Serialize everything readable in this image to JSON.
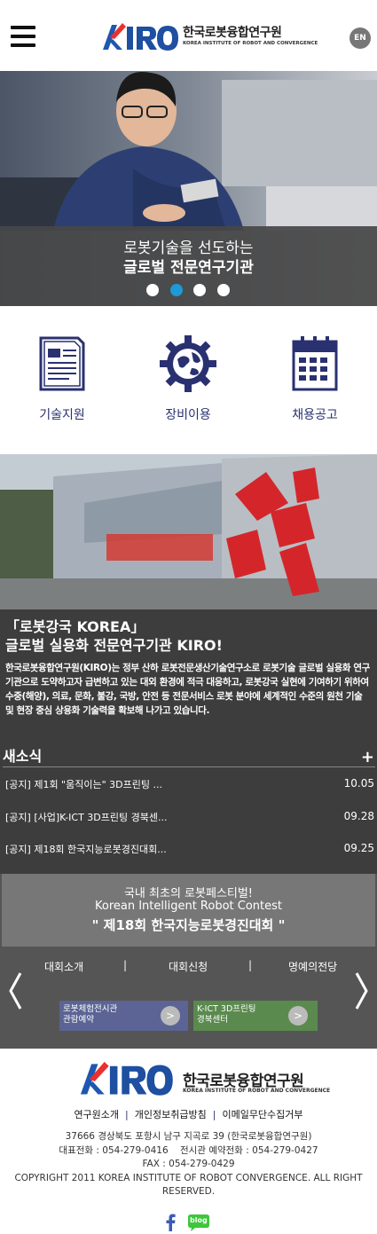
{
  "header": {
    "logo_ko": "한국로봇융합연구원",
    "logo_en": "KOREA INSTITUTE OF ROBOT AND CONVERGENCE",
    "lang": "EN"
  },
  "hero": {
    "line1": "로봇기술을 선도하는",
    "line2": "글로벌 전문연구기관",
    "slides": 4,
    "active_slide": 2
  },
  "quick_menu": [
    {
      "label": "기술지원",
      "icon": "document-icon"
    },
    {
      "label": "장비이용",
      "icon": "gear-globe-icon"
    },
    {
      "label": "채용공고",
      "icon": "calendar-icon"
    }
  ],
  "intro": {
    "title1": "「로봇강국 KOREA」",
    "title2": "글로벌 실용화 전문연구기관 KIRO!",
    "body": "한국로봇융합연구원(KIRO)는 정부 산하 로봇전문생산기술연구소로 로봇기술 글로벌 실용화 연구기관으로 도약하고자 급변하고 있는 대외 환경에 적극 대응하고, 로봇강국 실현에 기여하기 위하여 수중(해양), 의료, 문화, 불강, 국방, 안전 등 전문서비스 로봇 분야에 세계적인 수준의 원천 기술 및 현장 중심 상용화 기술력을 확보해 나가고 있습니다."
  },
  "news": {
    "heading": "새소식",
    "more": "+",
    "items": [
      {
        "title": "[공지] 제1회 \"움직이는\" 3D프린팅 ...",
        "date": "10.05"
      },
      {
        "title": "[공지] [사업]K-ICT 3D프린팅 경북센...",
        "date": "09.28"
      },
      {
        "title": "[공지] 제18회 한국지능로봇경진대회...",
        "date": "09.25"
      }
    ]
  },
  "contest": {
    "line1": "국내 최초의 로봇페스티벌!",
    "line2": "Korean Intelligent Robot Contest",
    "line3": "\" 제18회 한국지능로봇경진대회 \"",
    "links": [
      "대회소개",
      "대회신청",
      "명예의전당"
    ],
    "sep": "|",
    "promos": [
      {
        "line1": "로봇체험전시관",
        "line2": "관람예약",
        "btn": ">",
        "color": "#5b6494"
      },
      {
        "line1": "K-ICT 3D프린팅",
        "line2": "경북센터",
        "btn": ">",
        "color": "#5a8a4e"
      }
    ]
  },
  "footer": {
    "logo_ko": "한국로봇융합연구원",
    "logo_en": "KOREA INSTITUTE OF ROBOT AND CONVERGENCE",
    "links": [
      "연구원소개",
      "개인정보취급방침",
      "이메일무단수집거부"
    ],
    "sep": "|",
    "address": "37666 경상북도 포항시 남구 지곡로 39 (한국로봇융합연구원)",
    "phone": "대표전화 : 054-279-0416    전시관 예약전화 : 054-279-0427",
    "fax": "FAX : 054-279-0429",
    "copyright": "COPYRIGHT 2011 KOREA INSTITUTE OF ROBOT CONVERGENCE. ALL RIGHT RESERVED.",
    "blog": "blog"
  }
}
